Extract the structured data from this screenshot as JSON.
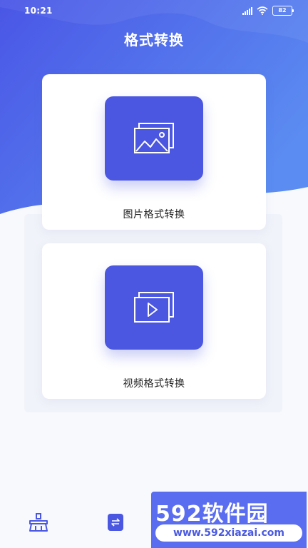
{
  "status_bar": {
    "time": "10:21",
    "battery": "82"
  },
  "header": {
    "title": "格式转换"
  },
  "cards": [
    {
      "label": "图片格式转换",
      "icon": "image-gallery-icon"
    },
    {
      "label": "视频格式转换",
      "icon": "video-play-icon"
    }
  ],
  "bottom_nav": [
    {
      "icon": "broom-clean-icon"
    },
    {
      "icon": "file-convert-icon",
      "active": true
    }
  ],
  "watermark": {
    "title": "592软件园",
    "url": "www.592xiazai.com"
  },
  "colors": {
    "accent": "#4b57e0",
    "header_gradient_start": "#4a56e6",
    "header_gradient_end": "#5a8af0"
  }
}
